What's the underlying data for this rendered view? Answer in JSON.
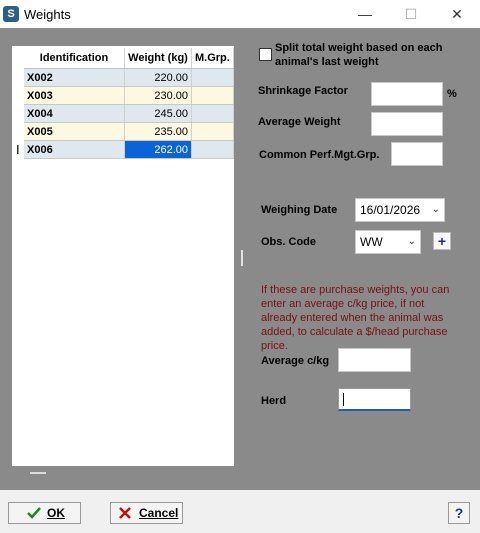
{
  "window": {
    "title": "Weights",
    "icon": "app-logo-icon",
    "minimize_glyph": "—",
    "maximize_glyph": "☐",
    "close_glyph": "✕"
  },
  "grid": {
    "columns": [
      "Identification",
      "Weight (kg)",
      "M.Grp."
    ],
    "rows": [
      {
        "id": "X002",
        "weight": "220.00",
        "mgrp": ""
      },
      {
        "id": "X003",
        "weight": "230.00",
        "mgrp": ""
      },
      {
        "id": "X004",
        "weight": "245.00",
        "mgrp": ""
      },
      {
        "id": "X005",
        "weight": "235.00",
        "mgrp": ""
      },
      {
        "id": "X006",
        "weight": "262.00",
        "mgrp": ""
      }
    ],
    "selected_row_index": 4,
    "row_cursor_glyph": "I"
  },
  "form": {
    "split_checkbox_label_line1": "Split total weight based on each",
    "split_checkbox_label_line2": "animal's last weight",
    "split_checked": false,
    "shrinkage_label": "Shrinkage Factor",
    "shrinkage_value": "",
    "shrinkage_unit": "%",
    "avg_weight_label": "Average Weight",
    "avg_weight_value": "",
    "common_perf_label": "Common Perf.Mgt.Grp.",
    "common_perf_value": "",
    "weighing_date_label": "Weighing Date",
    "weighing_date_value": "16/01/2026",
    "obs_code_label": "Obs. Code",
    "obs_code_value": "WW",
    "obs_add_glyph": "+",
    "purchase_note": "If these are purchase weights, you can enter an average c/kg price, if not already entered when the animal was added, to calculate a $/head purchase price.",
    "avg_ckg_label": "Average c/kg",
    "avg_ckg_value": "",
    "herd_label": "Herd",
    "herd_value": ""
  },
  "footer": {
    "ok_label": "OK",
    "ok_icon": "checkmark-icon",
    "cancel_label": "Cancel",
    "cancel_icon": "x-icon",
    "help_glyph": "?"
  },
  "colors": {
    "panel_bg": "#8a8a8a",
    "selected_cell": "#0a64d8",
    "row_blue": "#dfe8ee",
    "row_yellow": "#fdf9e0",
    "note_text": "#7a1010"
  }
}
